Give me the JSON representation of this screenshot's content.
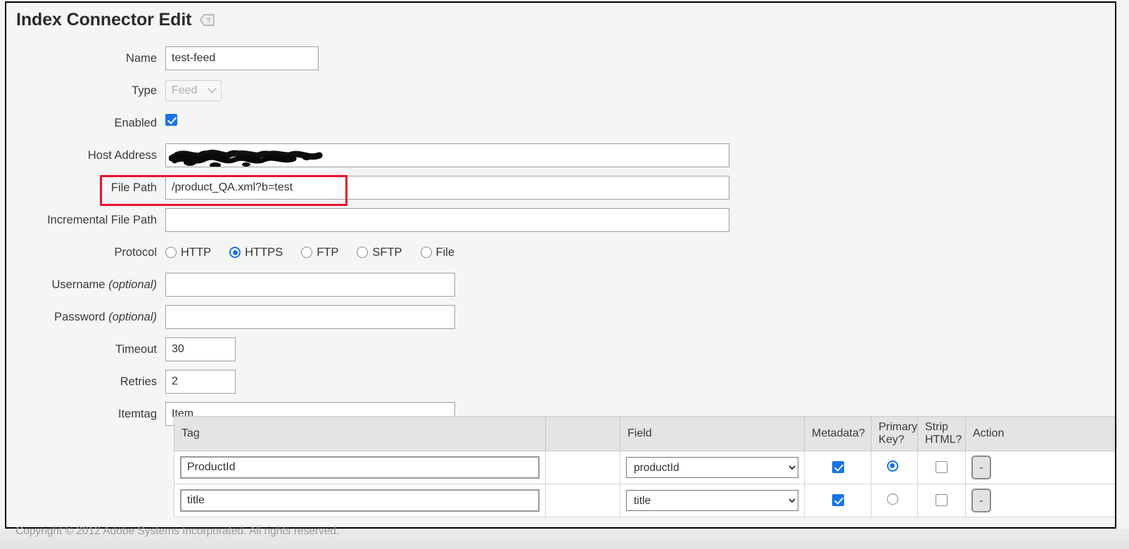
{
  "header": {
    "title": "Index Connector Edit",
    "help_icon": "help-question-icon"
  },
  "form": {
    "name": {
      "label": "Name",
      "value": "test-feed"
    },
    "type": {
      "label": "Type",
      "value": "Feed",
      "disabled": true,
      "chevron": "⌄"
    },
    "enabled": {
      "label": "Enabled",
      "checked": true
    },
    "host_address": {
      "label": "Host Address",
      "value": "",
      "redacted": true
    },
    "file_path": {
      "label": "File Path",
      "value": "/product_QA.xml?b=test",
      "highlighted": true
    },
    "incremental_file_path": {
      "label": "Incremental File Path",
      "value": ""
    },
    "protocol": {
      "label": "Protocol",
      "selected": "HTTPS",
      "options": [
        "HTTP",
        "HTTPS",
        "FTP",
        "SFTP",
        "File"
      ]
    },
    "username": {
      "label": "Username",
      "optional_suffix": "(optional)",
      "value": ""
    },
    "password": {
      "label": "Password",
      "optional_suffix": "(optional)",
      "value": ""
    },
    "timeout": {
      "label": "Timeout",
      "value": "30"
    },
    "retries": {
      "label": "Retries",
      "value": "2"
    },
    "itemtag": {
      "label": "Itemtag",
      "value": "Item"
    }
  },
  "mapping_table": {
    "columns": [
      "Tag",
      "",
      "Field",
      "Metadata?",
      "Primary Key?",
      "Strip HTML?",
      "Action"
    ],
    "headers": {
      "tag": "Tag",
      "spacer": "",
      "field": "Field",
      "metadata": "Metadata?",
      "primary_key_line1": "Primary",
      "primary_key_line2": "Key?",
      "strip_line1": "Strip",
      "strip_line2": "HTML?",
      "action": "Action"
    },
    "rows": [
      {
        "tag": "ProductId",
        "field": "productId",
        "metadata": true,
        "primary_key": true,
        "strip_html": false,
        "action_label": "-"
      },
      {
        "tag": "title",
        "field": "title",
        "metadata": true,
        "primary_key": false,
        "strip_html": false,
        "action_label": "-"
      }
    ]
  },
  "footer": {
    "copyright": "Copyright © 2012 Adobe Systems Incorporated. All rights reserved."
  },
  "colors": {
    "highlight_red": "#e8112d",
    "accent_blue": "#1a73e8",
    "page_bg": "#f5f5f5",
    "table_header_bg": "#e4e4e4"
  }
}
